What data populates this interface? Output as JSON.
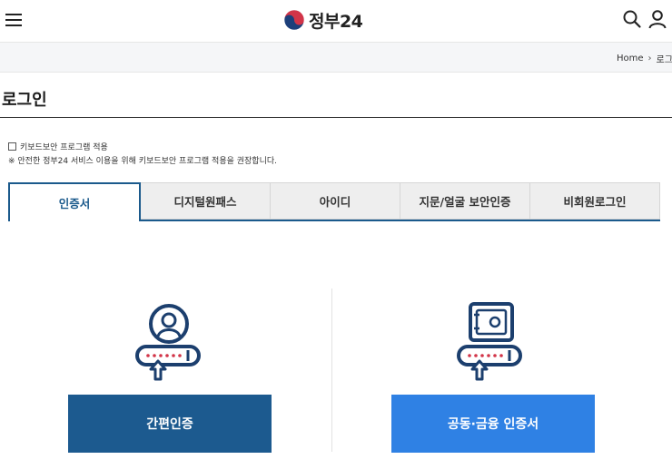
{
  "header": {
    "logo_text": "정부24",
    "icons": [
      "hamburger-menu-icon",
      "taegeuk-logo-icon",
      "search-icon",
      "user-icon"
    ]
  },
  "breadcrumb": {
    "home": "Home",
    "current": "로그인"
  },
  "page": {
    "title": "로그인"
  },
  "keyboard_security": {
    "checkbox_label": "키보드보안 프로그램 적용",
    "checked": false,
    "notice": "※ 안전한 정부24 서비스 이용을 위해 키보드보안 프로그램 적용을 권장합니다."
  },
  "tabs": [
    {
      "label": "인증서",
      "active": true
    },
    {
      "label": "디지털원패스",
      "active": false
    },
    {
      "label": "아이디",
      "active": false
    },
    {
      "label": "지문/얼굴 보안인증",
      "active": false
    },
    {
      "label": "비회원로그인",
      "active": false
    }
  ],
  "auth_options": {
    "simple_label": "간편인증",
    "certificate_label": "공동·금융 인증서"
  },
  "colors": {
    "primary_dark": "#1c5a8f",
    "primary_bright": "#2f81e4",
    "icon_navy": "#1c3f6e",
    "icon_red": "#d23448"
  }
}
